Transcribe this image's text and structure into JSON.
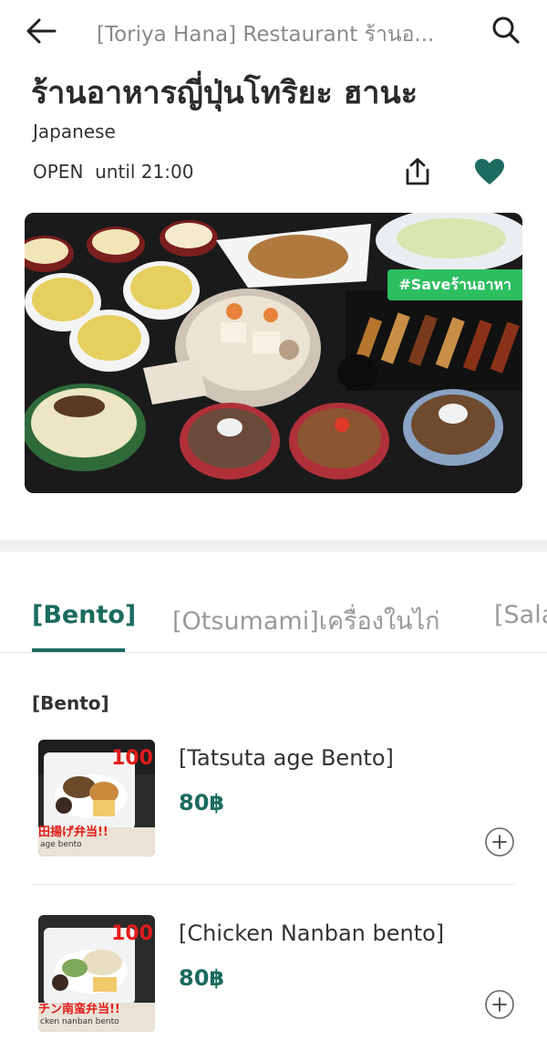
{
  "header": {
    "title": "[Toriya Hana] Restaurant ร้านอ...",
    "icons": {
      "back": "back-arrow-icon",
      "search": "search-icon"
    }
  },
  "store": {
    "name": "ร้านอาหารญี่ปุ่นโทริยะ ฮานะ",
    "cuisine": "Japanese",
    "status": "OPEN",
    "hours": "until 21:00",
    "favorited": true,
    "icons": {
      "share": "share-icon",
      "favorite": "heart-icon"
    }
  },
  "hero": {
    "badge": "#Saveร้านอาหา"
  },
  "tabs": [
    {
      "label": "[Bento]",
      "active": true
    },
    {
      "label": "[Otsumami]เครื่องในไก่",
      "active": false
    },
    {
      "label": "[Sala",
      "active": false
    }
  ],
  "section": {
    "title": "[Bento]"
  },
  "menu": {
    "items": [
      {
        "name": "[Tatsuta age Bento]",
        "price": "80฿",
        "thumb_text": "田揚げ弁当!!",
        "thumb_price": "100",
        "thumb_caption": "age bento"
      },
      {
        "name": "[Chicken Nanban bento]",
        "price": "80฿",
        "thumb_text": "チン南蛮弁当!!",
        "thumb_price": "100",
        "thumb_caption": "cken nanban bento"
      }
    ]
  },
  "colors": {
    "brand": "#1b6b5f",
    "muted": "#9a9a9a",
    "badge": "#2dbe60",
    "divider": "#f1f1f1"
  }
}
